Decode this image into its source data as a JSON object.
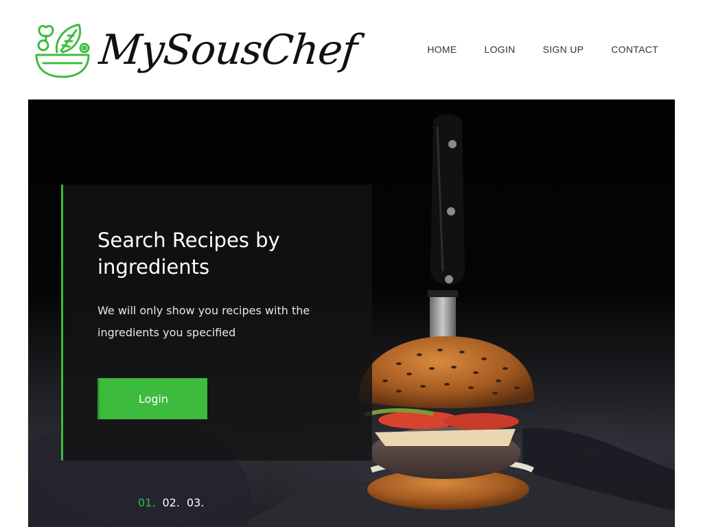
{
  "brand": {
    "name": "MySousChef",
    "accent_color": "#3dbb3d"
  },
  "nav": {
    "items": [
      {
        "label": "HOME"
      },
      {
        "label": "LOGIN"
      },
      {
        "label": "SIGN UP"
      },
      {
        "label": "CONTACT"
      }
    ]
  },
  "hero": {
    "title": "Search Recipes by ingredients",
    "description": "We will only show you recipes with the ingredients you specified",
    "button_label": "Login",
    "slides": [
      {
        "label": "01.",
        "active": true
      },
      {
        "label": "02.",
        "active": false
      },
      {
        "label": "03.",
        "active": false
      }
    ],
    "background_image": "burger-with-knife"
  }
}
